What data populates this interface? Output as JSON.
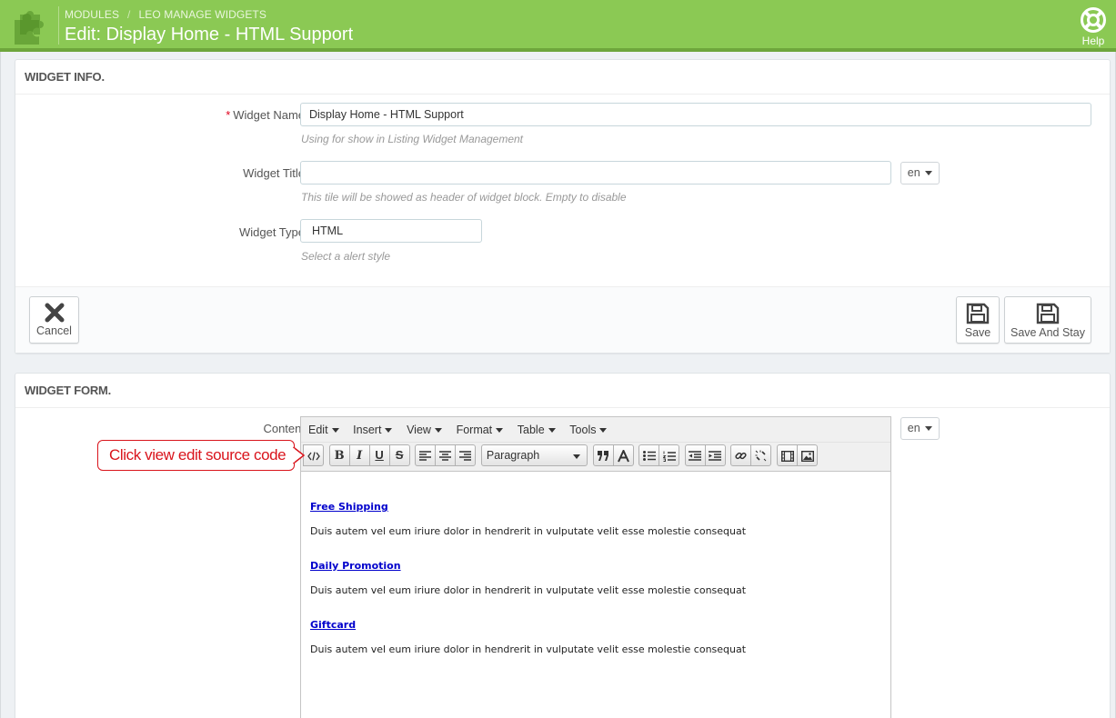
{
  "header": {
    "breadcrumb": [
      "MODULES",
      "LEO MANAGE WIDGETS"
    ],
    "breadcrumb_sep": "/",
    "title": "Edit: Display Home - HTML Support",
    "help_label": "Help",
    "bg_color": "#8bc954"
  },
  "widget_info": {
    "heading": "WIDGET INFO.",
    "name_label": "Widget Name",
    "name_required_mark": "*",
    "name_value": "Display Home - HTML Support",
    "name_hint": "Using for show in Listing Widget Management",
    "title_label": "Widget Title",
    "title_value": "",
    "title_lang": "en",
    "title_hint": "This tile will be showed as header of widget block. Empty to disable",
    "type_label": "Widget Type",
    "type_value": "HTML",
    "type_hint": "Select a alert style",
    "cancel_label": "Cancel",
    "save_label": "Save",
    "save_stay_label": "Save And Stay"
  },
  "widget_form": {
    "heading": "WIDGET FORM.",
    "content_label": "Content",
    "content_lang": "en",
    "editor": {
      "menus": [
        "Edit",
        "Insert",
        "View",
        "Format",
        "Table",
        "Tools"
      ],
      "block_format": "Paragraph",
      "toolbar_icons": [
        "source-code-icon",
        "bold-icon",
        "italic-icon",
        "underline-icon",
        "strikethrough-icon",
        "align-left-icon",
        "align-center-icon",
        "align-right-icon",
        "format-select",
        "blockquote-icon",
        "text-color-icon",
        "bullet-list-icon",
        "numbered-list-icon",
        "outdent-icon",
        "indent-icon",
        "link-icon",
        "unlink-icon",
        "media-icon",
        "image-icon"
      ],
      "content": [
        {
          "heading": "Free Shipping",
          "text": "Duis autem vel eum iriure dolor in hendrerit in vulputate velit esse molestie consequat"
        },
        {
          "heading": "Daily Promotion",
          "text": "Duis autem vel eum iriure dolor in hendrerit in vulputate velit esse molestie consequat"
        },
        {
          "heading": "Giftcard",
          "text": "Duis autem vel eum iriure dolor in hendrerit in vulputate velit esse molestie consequat"
        }
      ]
    }
  },
  "annotation": {
    "text": "Click view edit source code",
    "color": "#d9141c"
  }
}
